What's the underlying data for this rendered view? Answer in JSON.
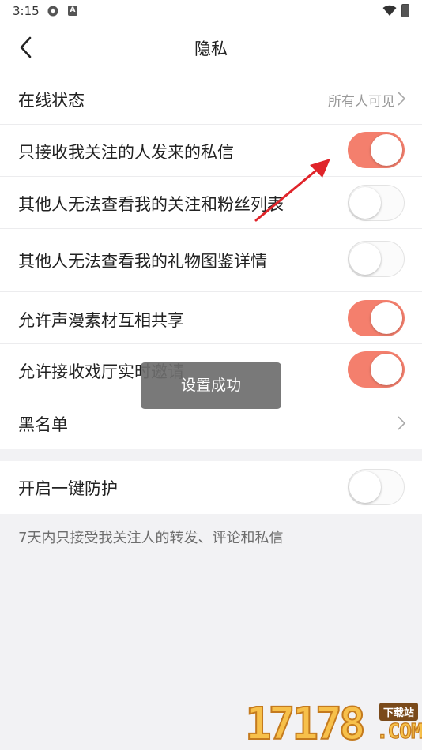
{
  "status_bar": {
    "time": "3:15",
    "icons": [
      "sync-icon",
      "a-badge-icon",
      "wifi-icon",
      "battery-icon"
    ]
  },
  "header": {
    "title": "隐私",
    "back_icon": "chevron-left-icon"
  },
  "settings": {
    "online_status": {
      "label": "在线状态",
      "value": "所有人可见"
    },
    "only_followed_messages": {
      "label": "只接收我关注的人发来的私信",
      "enabled": true
    },
    "hide_follow_lists": {
      "label": "其他人无法查看我的关注和粉丝列表",
      "enabled": false
    },
    "hide_gift_details": {
      "label": "其他人无法查看我的礼物图鉴详情",
      "enabled": false
    },
    "allow_material_sharing": {
      "label": "允许声漫素材互相共享",
      "enabled": true
    },
    "allow_hall_invites": {
      "label": "允许接收戏厅实时邀请",
      "enabled": true
    },
    "blacklist": {
      "label": "黑名单"
    },
    "one_click_protection": {
      "label": "开启一键防护",
      "enabled": false
    }
  },
  "footer_note": "7天内只接受我关注人的转发、评论和私信",
  "toast": {
    "message": "设置成功"
  },
  "watermark": {
    "digits": "17178",
    "tag": "下载站",
    "suffix": ".COM"
  },
  "colors": {
    "toggle_on": "#f47f6d",
    "toggle_off": "#fbfbfb",
    "annotation_arrow": "#e0242a",
    "page_background": "#f2f2f4"
  }
}
